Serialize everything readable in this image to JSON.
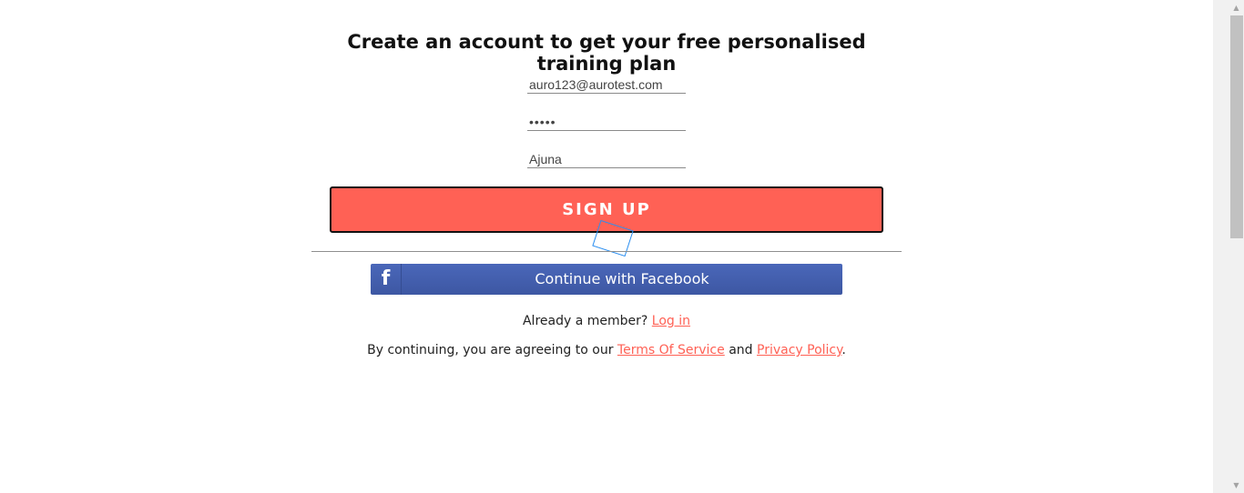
{
  "heading": "Create an account to get your free personalised training plan",
  "form": {
    "email_value": "auro123@aurotest.com",
    "password_value": "•••••",
    "name_value": "Ajuna"
  },
  "signup_label": "SIGN UP",
  "facebook": {
    "icon_glyph": "f",
    "label": "Continue with Facebook"
  },
  "member": {
    "text": "Already a member?",
    "login_link": "Log in"
  },
  "terms": {
    "prefix": "By continuing, you are agreeing to our",
    "tos_link": "Terms Of Service",
    "and": "and",
    "privacy_link": "Privacy Policy",
    "suffix": "."
  },
  "scrollbar": {
    "up_arrow": "▲",
    "down_arrow": "▼"
  },
  "colors": {
    "accent": "#ff6155",
    "facebook": "#4460b0"
  }
}
